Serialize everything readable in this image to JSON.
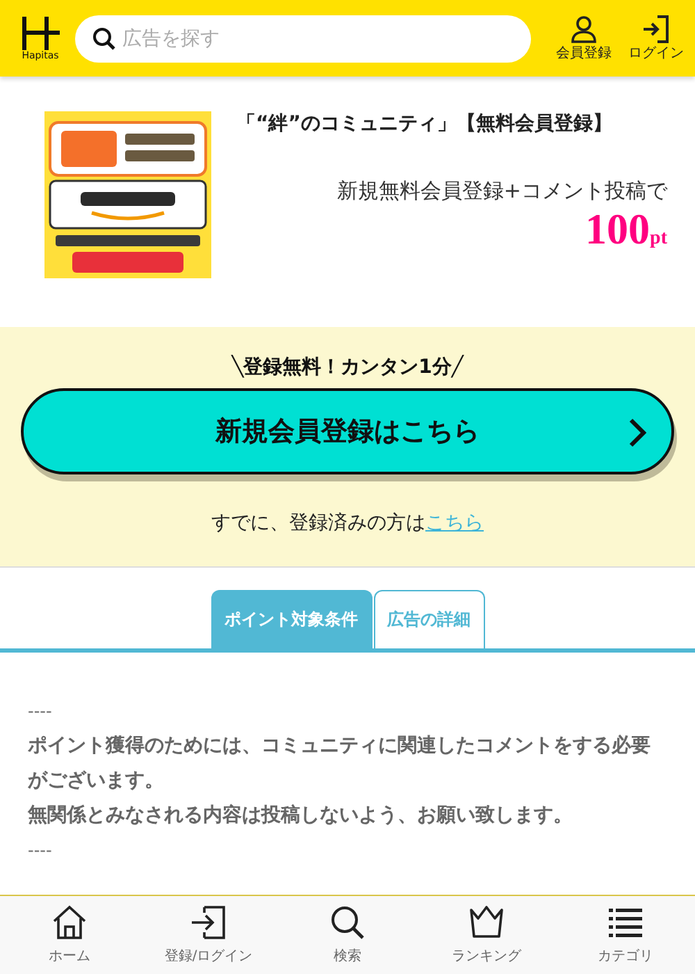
{
  "header": {
    "logo": "Hapitas",
    "search": {
      "placeholder": "広告を探す"
    },
    "actions": [
      {
        "kind": "user",
        "label": "会員登録"
      },
      {
        "kind": "login",
        "label": "ログイン"
      }
    ]
  },
  "ad": {
    "title": "「“絆”のコミュニティ」【無料会員登録】",
    "condition": "新規無料会員登録+コメント投稿で",
    "points": "100",
    "unit": "pt"
  },
  "signup": {
    "tagline": "╲登録無料！カンタン1分╱",
    "button": "新規会員登録はこちら",
    "login_text": "すでに、登録済みの方は",
    "login_link": "こちら"
  },
  "tabs": [
    {
      "label": "ポイント対象条件",
      "selected": true
    },
    {
      "label": "広告の詳細",
      "selected": false
    }
  ],
  "body": [
    "----",
    "ポイント獲得のためには、コミュニティに関連したコメントをする必要がございます。",
    "無関係とみなされる内容は投稿しないよう、お願い致します。",
    "----"
  ],
  "bottom_nav": [
    {
      "kind": "home",
      "label": "ホーム"
    },
    {
      "kind": "login",
      "label": "登録/ログイン"
    },
    {
      "kind": "search",
      "label": "検索"
    },
    {
      "kind": "ranking",
      "label": "ランキング"
    },
    {
      "kind": "category",
      "label": "カテゴリ"
    }
  ]
}
